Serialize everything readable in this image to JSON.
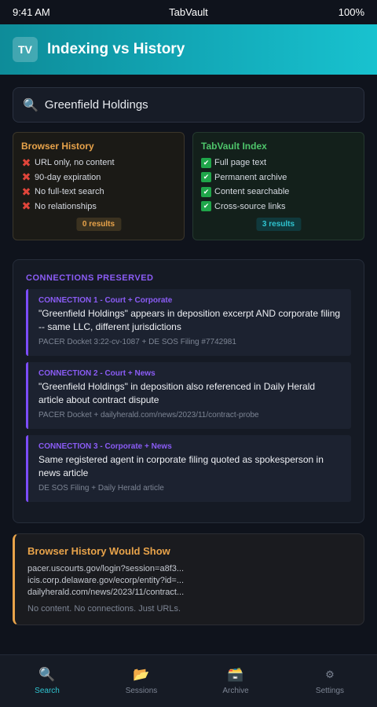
{
  "status_bar": {
    "time": "9:41 AM",
    "app": "TabVault",
    "battery": "100%"
  },
  "header": {
    "logo": "TV",
    "title": "Indexing vs History"
  },
  "search": {
    "icon": "search-icon",
    "value": "Greenfield Holdings"
  },
  "comparison": {
    "history": {
      "title": "Browser History",
      "features": [
        "URL only, no content",
        "90-day expiration",
        "No full-text search",
        "No relationships"
      ],
      "result_count": "0 results"
    },
    "index": {
      "title": "TabVault Index",
      "features": [
        "Full page text",
        "Permanent archive",
        "Content searchable",
        "Cross-source links"
      ],
      "result_count": "3 results"
    }
  },
  "connections": {
    "title": "CONNECTIONS PRESERVED",
    "items": [
      {
        "label": "CONNECTION 1 - Court + Corporate",
        "text": "\"Greenfield Holdings\" appears in deposition excerpt AND corporate filing -- same LLC, different jurisdictions",
        "source": "PACER Docket 3:22-cv-1087 + DE SOS Filing #7742981"
      },
      {
        "label": "CONNECTION 2 - Court + News",
        "text": "\"Greenfield Holdings\" in deposition also referenced in Daily Herald article about contract dispute",
        "source": "PACER Docket + dailyherald.com/news/2023/11/contract-probe"
      },
      {
        "label": "CONNECTION 3 - Corporate + News",
        "text": "Same registered agent in corporate filing quoted as spokesperson in news article",
        "source": "DE SOS Filing + Daily Herald article"
      }
    ]
  },
  "would_show": {
    "title": "Browser History Would Show",
    "urls": [
      "pacer.uscourts.gov/login?session=a8f3...",
      "icis.corp.delaware.gov/ecorp/entity?id=...",
      "dailyherald.com/news/2023/11/contract..."
    ],
    "note": "No content. No connections. Just URLs."
  },
  "tabs": [
    {
      "label": "Search",
      "icon": "search-icon",
      "glyph": "🔍"
    },
    {
      "label": "Sessions",
      "icon": "folder-icon",
      "glyph": "📂"
    },
    {
      "label": "Archive",
      "icon": "archive-icon",
      "glyph": "🗃️"
    },
    {
      "label": "Settings",
      "icon": "gear-icon",
      "glyph": "⚙"
    }
  ],
  "colors": {
    "accent": "#2fc4d0",
    "history": "#e8a34a",
    "index": "#4ec56b",
    "connection": "#8b5cf6"
  }
}
